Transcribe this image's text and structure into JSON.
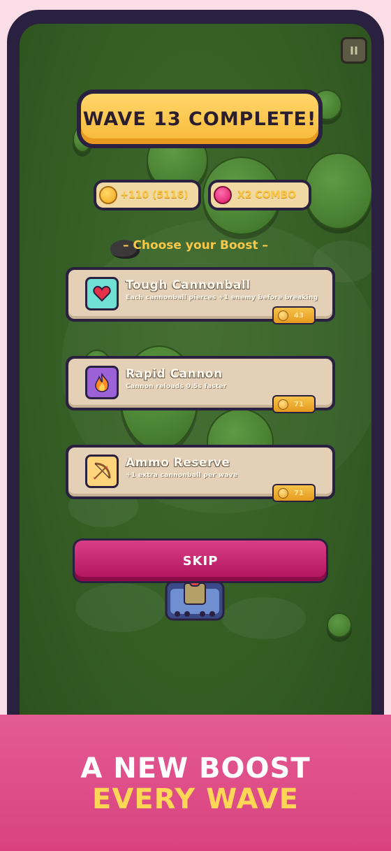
{
  "game": {
    "title": "WAVE 13 COMPLETE!",
    "reward": {
      "coins_text": "+110 (5116)",
      "combo_text": "X2 COMBO"
    },
    "choose_label": "– Choose your Boost –",
    "boosts": [
      {
        "name": "Tough Cannonball",
        "desc": "Each cannonball pierces +1 enemy before breaking",
        "price": "43",
        "icon": "heart-icon",
        "icon_color": "#6fe0d3"
      },
      {
        "name": "Rapid Cannon",
        "desc": "Cannon reloads 0.5s faster",
        "price": "71",
        "icon": "fire-icon",
        "icon_color": "#9b62d8"
      },
      {
        "name": "Ammo Reserve",
        "desc": "+1 extra cannonball per wave",
        "price": "71",
        "icon": "bow-icon",
        "icon_color": "#ffd47a"
      }
    ],
    "skip_label": "SKIP",
    "pause_label": "II"
  },
  "banner": {
    "line1": "A NEW BOOST",
    "line2": "EVERY WAVE"
  },
  "colors": {
    "accent": "#d9427f",
    "gold": "#f7c84a",
    "frame": "#2a2040"
  }
}
